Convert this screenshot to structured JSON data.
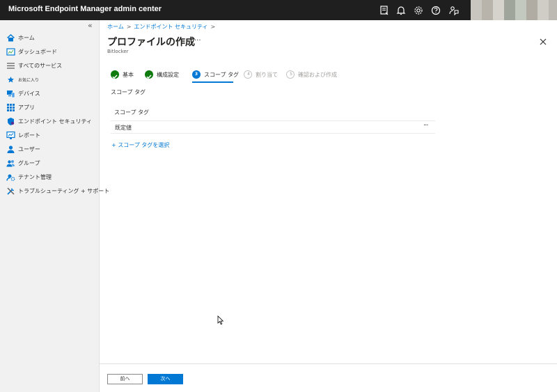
{
  "app": {
    "title": "Microsoft Endpoint Manager admin center"
  },
  "sidebar": {
    "collapse_glyph": "«",
    "items": [
      {
        "label": "ホーム",
        "icon": "home-icon"
      },
      {
        "label": "ダッシュボード",
        "icon": "dashboard-icon"
      },
      {
        "label": "すべてのサービス",
        "icon": "list-icon"
      },
      {
        "label": "お気に入り",
        "icon": "star-icon"
      },
      {
        "label": "デバイス",
        "icon": "devices-icon"
      },
      {
        "label": "アプリ",
        "icon": "apps-icon"
      },
      {
        "label": "エンドポイント セキュリティ",
        "icon": "shield-icon"
      },
      {
        "label": "レポート",
        "icon": "reports-icon"
      },
      {
        "label": "ユーザー",
        "icon": "user-icon"
      },
      {
        "label": "グループ",
        "icon": "group-icon"
      },
      {
        "label": "テナント管理",
        "icon": "tenant-icon"
      },
      {
        "label": "トラブルシューティング + サポート",
        "icon": "tools-icon"
      }
    ]
  },
  "breadcrumb": {
    "home": "ホーム",
    "security": "エンドポイント セキュリティ",
    "sep": ">"
  },
  "page": {
    "title": "プロファイルの作成",
    "subtitle": "Bitlocker",
    "more": "···"
  },
  "steps": [
    {
      "label": "基本",
      "state": "done"
    },
    {
      "label": "構成設定",
      "state": "done"
    },
    {
      "number": "3",
      "label": "スコープ タグ",
      "state": "current"
    },
    {
      "number": "4",
      "label": "割り当て",
      "state": "todo"
    },
    {
      "number": "5",
      "label": "確認および作成",
      "state": "todo"
    }
  ],
  "scope": {
    "heading": "スコープ タグ",
    "column_header": "スコープ タグ",
    "rows": [
      {
        "value": "既定値",
        "more": "···"
      }
    ],
    "select_link": "+ スコープ タグを選択"
  },
  "footer": {
    "prev_label": "前へ",
    "next_label": "次へ"
  },
  "colors": {
    "accent": "#0078d4",
    "success": "#0f7b0f",
    "topbar": "#1f1f1f",
    "sidebar": "#f1f1f1"
  }
}
